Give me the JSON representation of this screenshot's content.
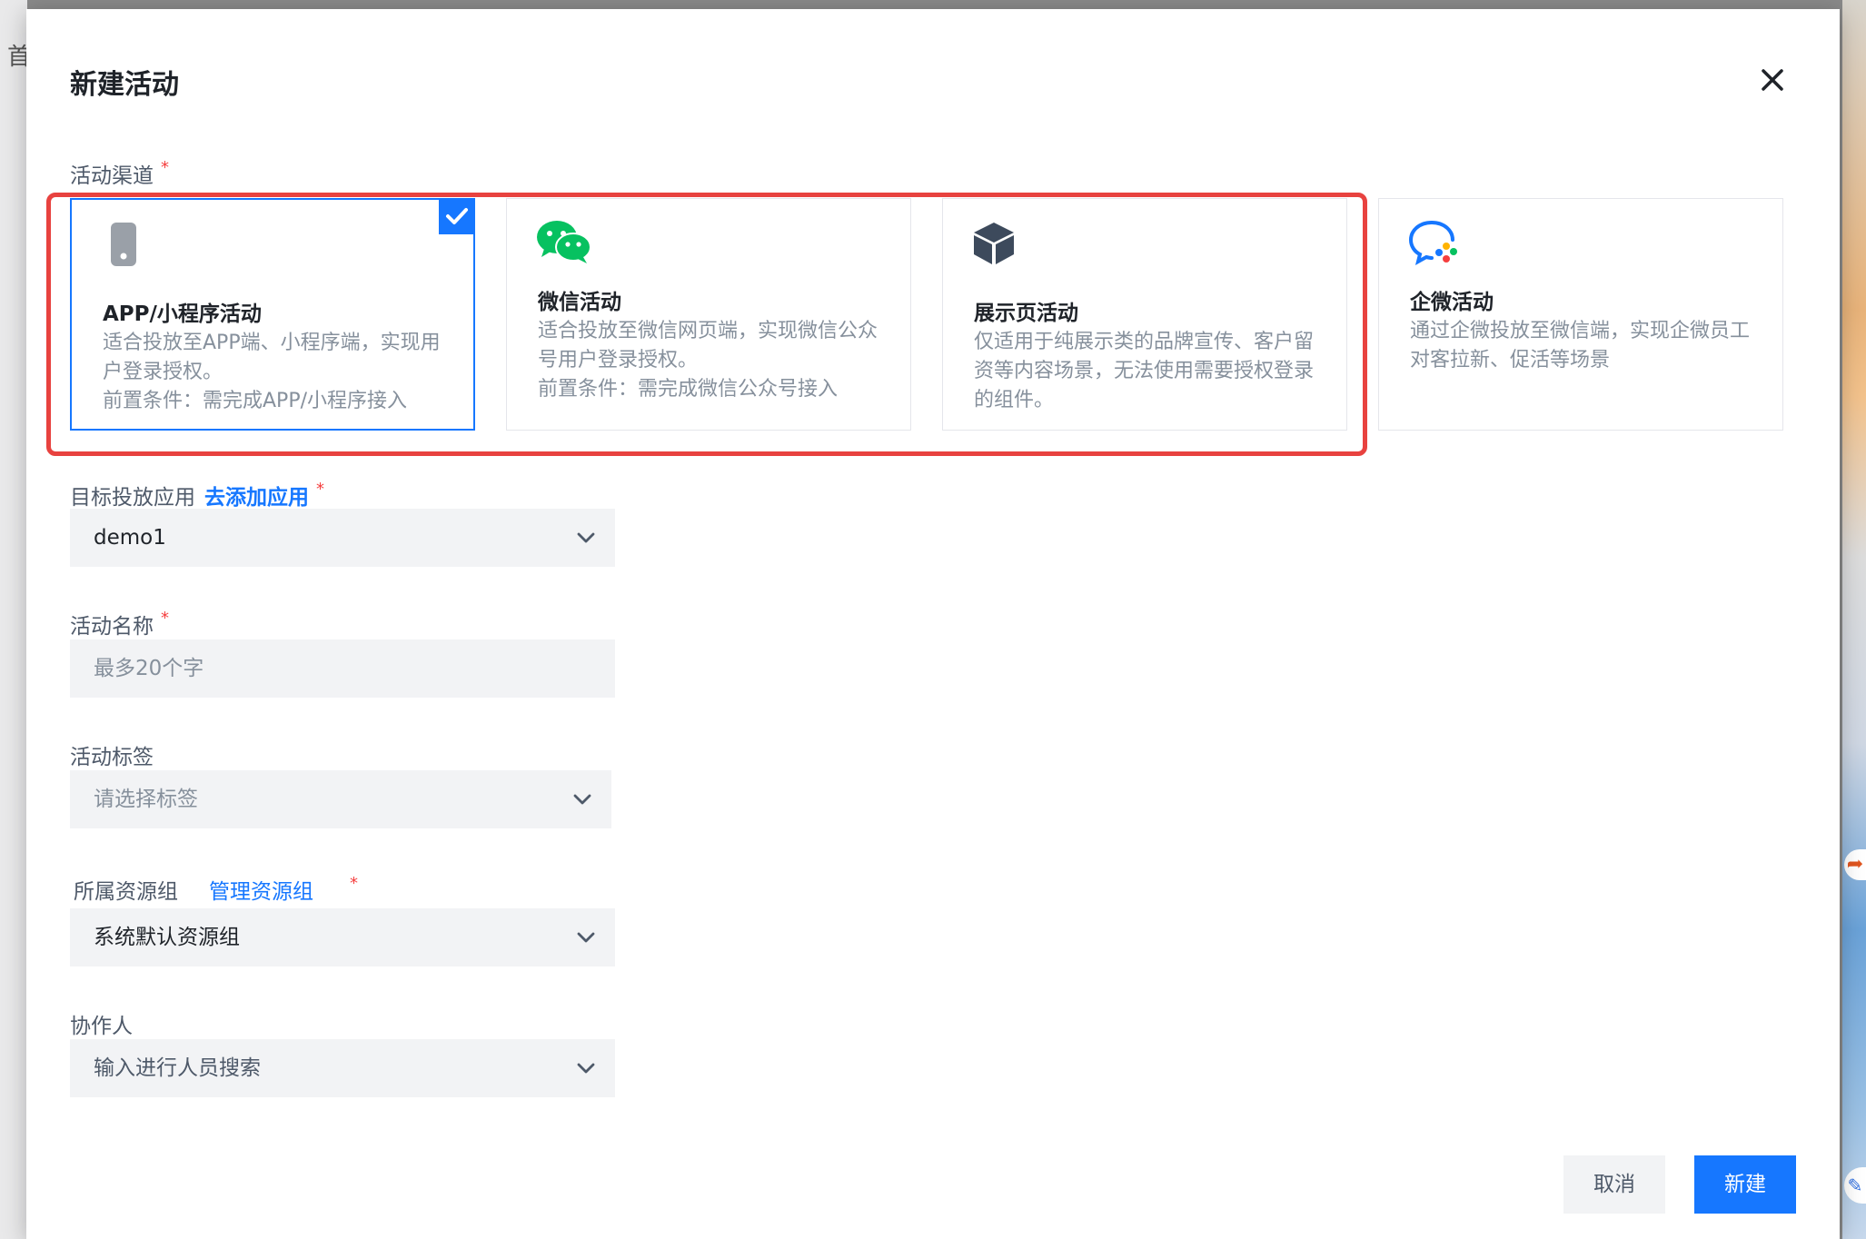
{
  "background": {
    "left_text": "首"
  },
  "modal": {
    "title": "新建活动",
    "close_icon": "close-icon"
  },
  "channel": {
    "label": "活动渠道",
    "required_mark": "*",
    "cards": [
      {
        "title": "APP/小程序活动",
        "desc": "适合投放至APP端、小程序端，实现用户登录授权。",
        "condition": "前置条件：需完成APP/小程序接入",
        "icon": "phone-icon",
        "selected": true
      },
      {
        "title": "微信活动",
        "desc": "适合投放至微信网页端，实现微信公众号用户登录授权。",
        "condition": "前置条件：需完成微信公众号接入",
        "icon": "wechat-icon",
        "selected": false
      },
      {
        "title": "展示页活动",
        "desc": "仅适用于纯展示类的品牌宣传、客户留资等内容场景，无法使用需要授权登录的组件。",
        "condition": "",
        "icon": "cube-icon",
        "selected": false
      },
      {
        "title": "企微活动",
        "desc": "通过企微投放至微信端，实现企微员工对客拉新、促活等场景",
        "condition": "",
        "icon": "wecom-icon",
        "selected": false
      }
    ]
  },
  "target_app": {
    "label": "目标投放应用",
    "link": "去添加应用",
    "required_mark": "*",
    "value": "demo1"
  },
  "activity_name": {
    "label": "活动名称",
    "required_mark": "*",
    "placeholder": "最多20个字"
  },
  "activity_tag": {
    "label": "活动标签",
    "placeholder": "请选择标签"
  },
  "resource_group": {
    "label": "所属资源组",
    "link": "管理资源组",
    "required_mark": "*",
    "value": "系统默认资源组"
  },
  "collaborator": {
    "label": "协作人",
    "placeholder": "输入进行人员搜索"
  },
  "footer": {
    "cancel": "取消",
    "create": "新建"
  },
  "colors": {
    "primary": "#1677ff",
    "required": "#f53f3f",
    "highlight": "#e8423f",
    "wechat_green": "#07c160"
  }
}
